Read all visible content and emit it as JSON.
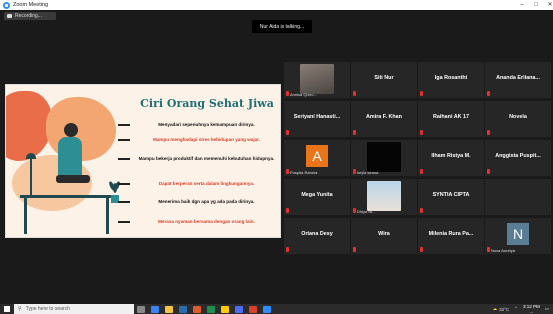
{
  "window": {
    "title": "Zoom Meeting",
    "minimize": "–",
    "maximize": "□",
    "close": "✕"
  },
  "meeting": {
    "recording_label": "Recording...",
    "talking_label": "Nur Aida is talking..."
  },
  "slide": {
    "title": "Ciri Orang Sehat Jiwa",
    "items": [
      {
        "text": "Menyadari sepenuhnya kemampuan dirinya.",
        "color": "#111111"
      },
      {
        "text": "Mampu menghadapi stres kehidupan yang wajar.",
        "color": "#d9412b"
      },
      {
        "text": "Mampu bekerja produktif dan memenuhi kebutuhan hidupnya.",
        "color": "#111111"
      },
      {
        "text": "Dapat berperan serta dalam lingkungannya.",
        "color": "#d9412b"
      },
      {
        "text": "Menerima baik dgn apa yg ada pada dirinya.",
        "color": "#111111"
      },
      {
        "text": "Merasa nyaman bersama dengan orang lain.",
        "color": "#d9412b"
      }
    ]
  },
  "participants": [
    {
      "name": "",
      "label": "Annisa Qurro...",
      "photo": "person"
    },
    {
      "name": "Siti Nur",
      "label": ""
    },
    {
      "name": "Iga Rosanthi",
      "label": ""
    },
    {
      "name": "Ananda Erliana...",
      "label": ""
    },
    {
      "name": "Seriyani Hanasti...",
      "label": ""
    },
    {
      "name": "Amira F. Khan",
      "label": ""
    },
    {
      "name": "Raihani AK 17",
      "label": ""
    },
    {
      "name": "Novela",
      "label": ""
    },
    {
      "name": "",
      "label": "Puspita Rahma",
      "letter": "A",
      "letter_bg": "#e8751a"
    },
    {
      "name": "",
      "label": "keyla kirana",
      "photo": "dark"
    },
    {
      "name": "Ilham Ristya M.",
      "label": ""
    },
    {
      "name": "Anggista Puspit...",
      "label": ""
    },
    {
      "name": "Mega Yunita",
      "label": ""
    },
    {
      "name": "",
      "label": "Dhiya Ni...",
      "photo": "girl"
    },
    {
      "name": "SYNTIA CIPTA",
      "label": ""
    },
    {
      "name": "",
      "label": ""
    },
    {
      "name": "Oriana Desy",
      "label": ""
    },
    {
      "name": "Wira",
      "label": ""
    },
    {
      "name": "Milenia Rura Pa...",
      "label": ""
    },
    {
      "name": "",
      "label": "Nova Auretya",
      "letter": "N",
      "letter_bg": "#5a7d96"
    }
  ],
  "taskbar": {
    "search_placeholder": "Type here to search",
    "weather": "32°C",
    "time": "3:12 PM",
    "date": "..."
  }
}
